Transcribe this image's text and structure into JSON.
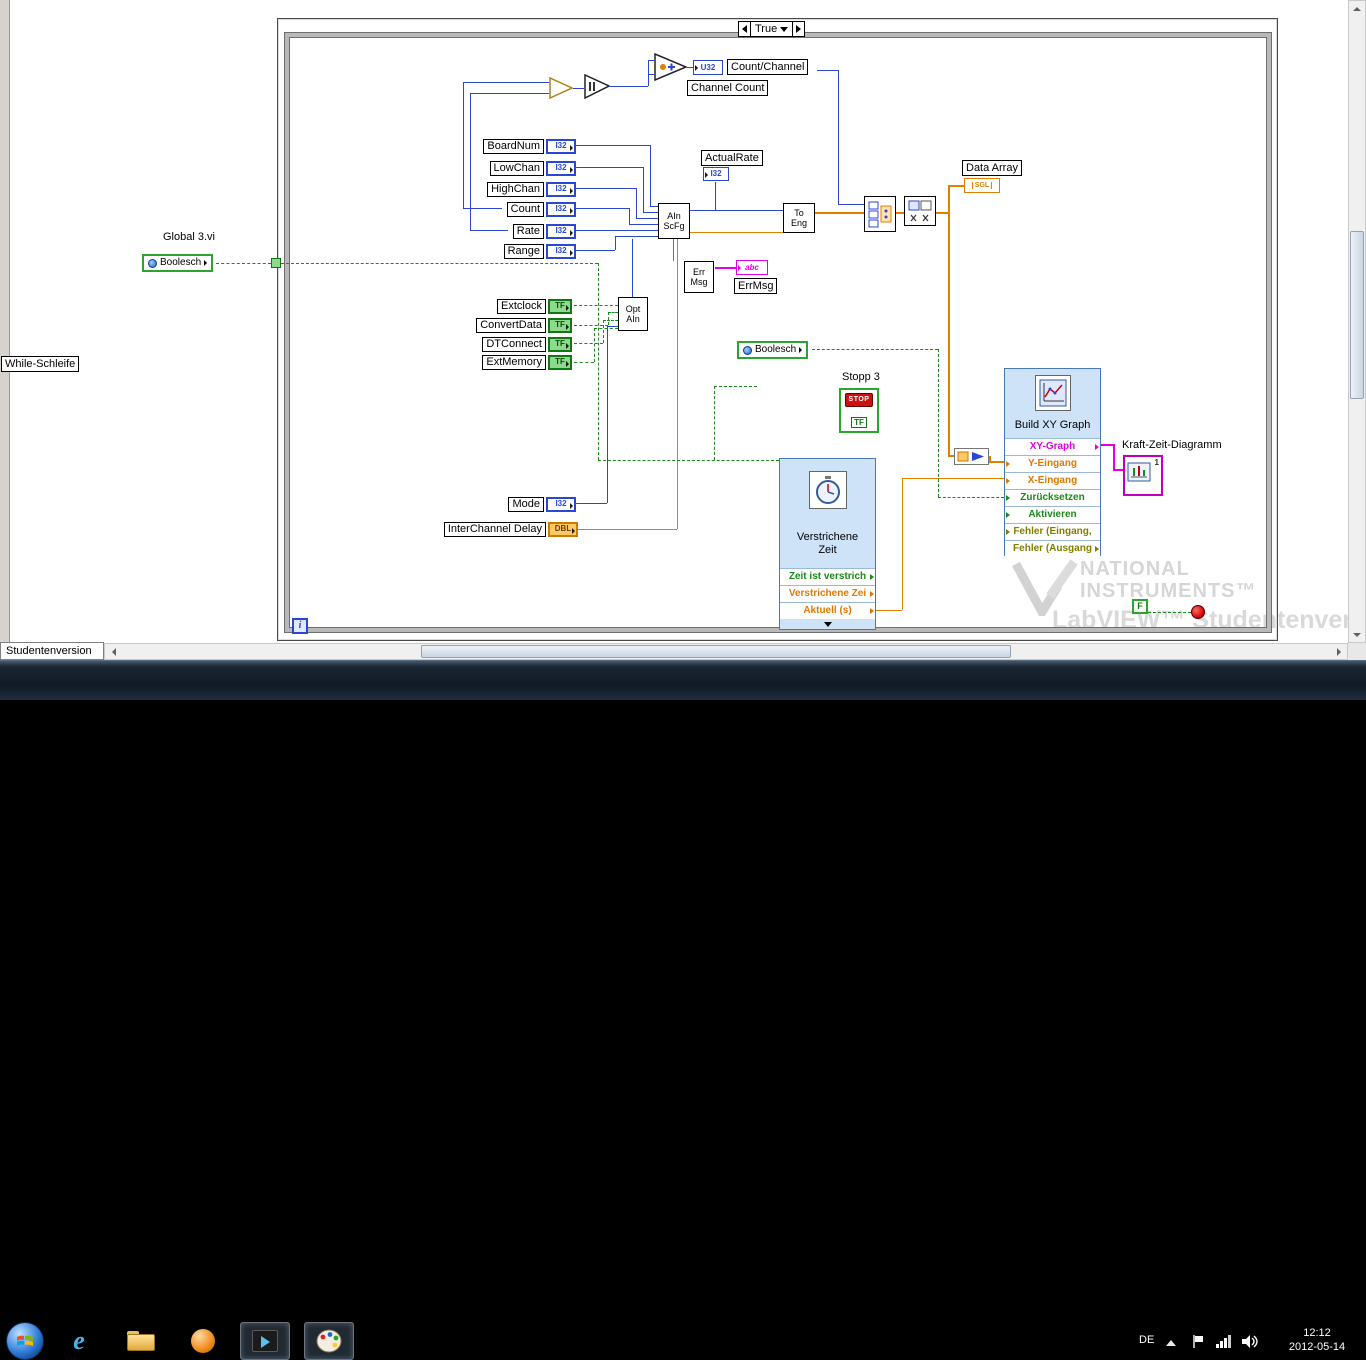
{
  "colors": {
    "integer_wire": "#2a47d4",
    "float_wire": "#e08000",
    "boolean_wire": "#1a8a1a",
    "string_wire": "#e400e4",
    "error_wire": "#808000",
    "express_vi_bg": "#cfe3f8"
  },
  "case_structure": {
    "selector_label": "True"
  },
  "while_loop": {
    "label": "While-Schleife",
    "iteration_label": "i",
    "stop_const": "F"
  },
  "global_vi": {
    "title": "Global 3.vi",
    "terminal1": "Boolesch",
    "terminal2": "Boolesch"
  },
  "controls": {
    "int_rows": [
      {
        "label": "BoardNum",
        "type": "I32"
      },
      {
        "label": "LowChan",
        "type": "I32"
      },
      {
        "label": "HighChan",
        "type": "I32"
      },
      {
        "label": "Count",
        "type": "I32"
      },
      {
        "label": "Rate",
        "type": "I32"
      },
      {
        "label": "Range",
        "type": "I32"
      }
    ],
    "bool_rows": [
      {
        "label": "Extclock",
        "type": "TF"
      },
      {
        "label": "ConvertData",
        "type": "TF"
      },
      {
        "label": "DTConnect",
        "type": "TF"
      },
      {
        "label": "ExtMemory",
        "type": "TF"
      }
    ],
    "mode": {
      "label": "Mode",
      "type": "I32"
    },
    "delay": {
      "label": "InterChannel Delay",
      "type": "DBL"
    },
    "stop": {
      "label": "Stopp 3",
      "button_text": "STOP",
      "type": "TF"
    }
  },
  "nodes": {
    "ain_l1": "AIn",
    "ain_l2": "ScFg",
    "toeng_l1": "To",
    "toeng_l2": "Eng",
    "err_l1": "Err",
    "err_l2": "Msg",
    "opt_l1": "Opt",
    "opt_l2": "AIn"
  },
  "indicators": {
    "actual_rate": {
      "label": "ActualRate",
      "type": "I32"
    },
    "err_msg": {
      "label": "ErrMsg",
      "type": "abc"
    },
    "count_channel": {
      "label": "Count/Channel",
      "type": "U32"
    },
    "channel_count_label": "Channel Count",
    "data_array": {
      "label": "Data Array",
      "type": "SGL"
    },
    "xy_graph": {
      "label": "Kraft-Zeit-Diagramm",
      "badge": "1"
    }
  },
  "express_elapsed": {
    "title": "Verstrichene Zeit",
    "rows": [
      "Zeit ist verstrich",
      "Verstrichene Zei",
      "Aktuell (s)"
    ]
  },
  "express_xy": {
    "title": "Build XY Graph",
    "rows": [
      "XY-Graph",
      "Y-Eingang",
      "X-Eingang",
      "Zurücksetzen",
      "Aktivieren",
      "Fehler (Eingang,",
      "Fehler (Ausgang"
    ]
  },
  "watermark": {
    "brand_line1": "NATIONAL",
    "brand_line2": "INSTRUMENTS™",
    "product": "LabVIEW™ Studentenversion"
  },
  "status": {
    "tab": "Studentenversion"
  },
  "taskbar": {
    "language": "DE",
    "time": "12:12",
    "date": "2012-05-14"
  }
}
